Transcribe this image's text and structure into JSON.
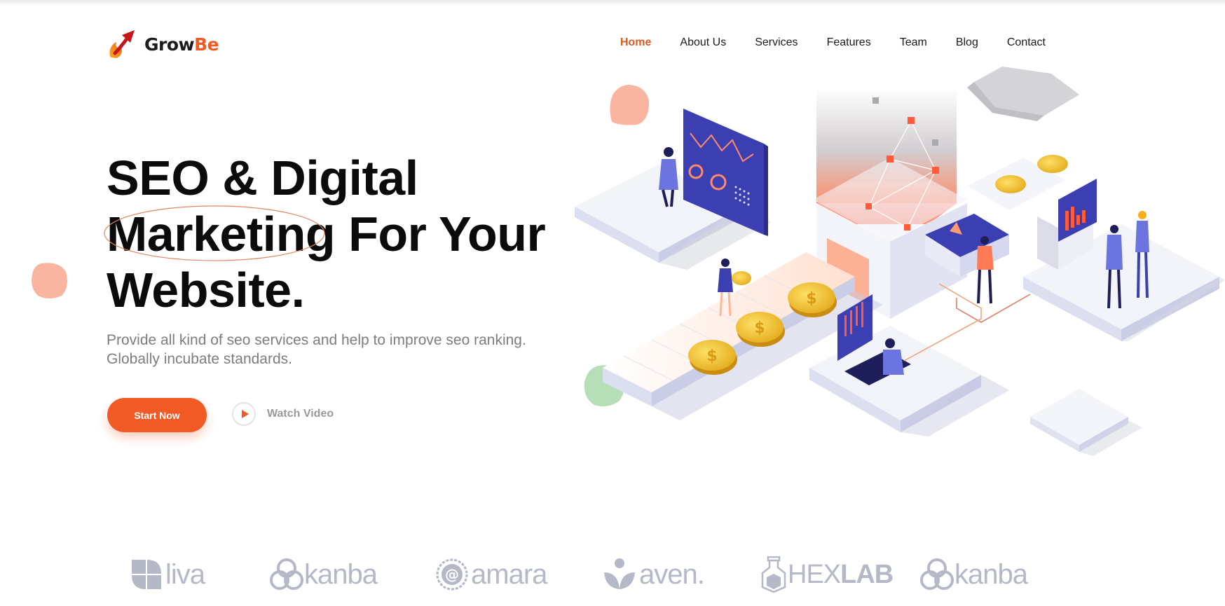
{
  "brand": {
    "name_main": "Grow",
    "name_accent": "Be",
    "accent_color": "#f15a24"
  },
  "nav": {
    "items": [
      {
        "label": "Home",
        "active": true
      },
      {
        "label": "About Us"
      },
      {
        "label": "Services"
      },
      {
        "label": "Features"
      },
      {
        "label": "Team"
      },
      {
        "label": "Blog"
      },
      {
        "label": "Contact"
      }
    ]
  },
  "hero": {
    "title_line1": "SEO & Digital",
    "title_highlight": "Marketing",
    "title_line2_rest": " For Your",
    "title_line3": "Website.",
    "subtitle_line1": "Provide all kind of seo services and help to improve seo ranking.",
    "subtitle_line2": "Globally incubate standards.",
    "start_label": "Start Now",
    "watch_label": "Watch Video"
  },
  "brands": {
    "logos": [
      {
        "name": "liva",
        "icon": "liva-icon"
      },
      {
        "name": "kanba",
        "icon": "kanba-rings-icon"
      },
      {
        "name": "amara",
        "icon": "amara-at-icon"
      },
      {
        "name": "aven.",
        "icon": "aven-leaf-icon"
      },
      {
        "name_light": "HEX",
        "name_bold": "LAB",
        "icon": "hexlab-flask-icon"
      },
      {
        "name": "kanba",
        "icon": "kanba-rings-icon"
      }
    ]
  },
  "colors": {
    "accent": "#f15a24",
    "text": "#0b0b0b",
    "muted": "#7d7d7d",
    "brand_gray": "#b4b8c7",
    "illus_blue": "#3b3fb2"
  }
}
